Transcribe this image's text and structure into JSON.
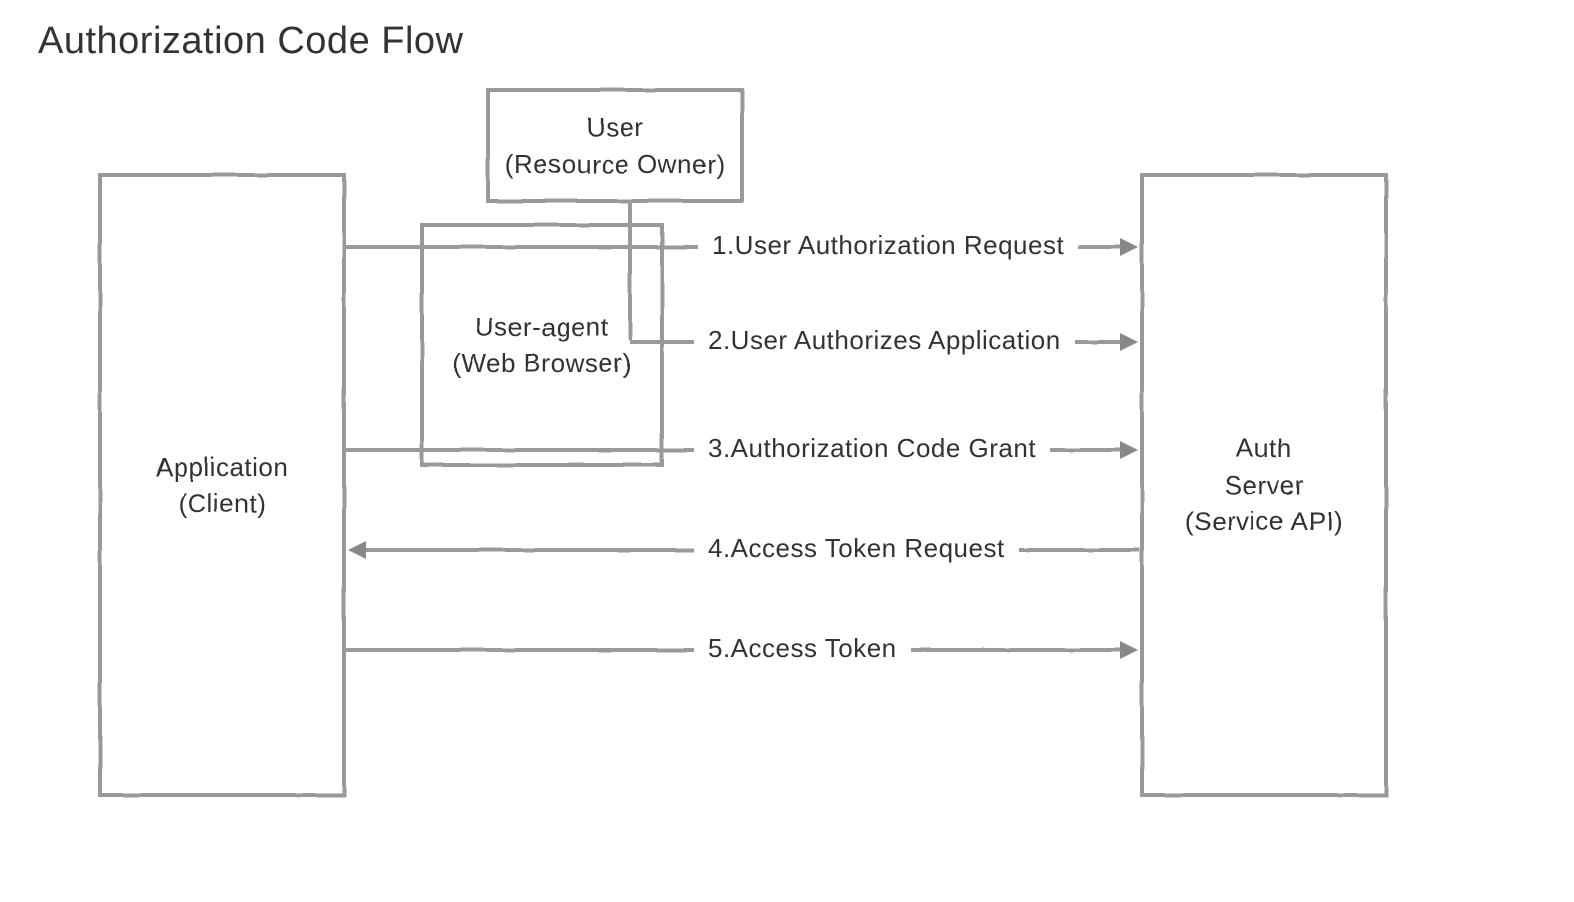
{
  "title": "Authorization Code Flow",
  "boxes": {
    "application": {
      "line1": "Application",
      "line2": "(Client)"
    },
    "user": {
      "line1": "User",
      "line2": "(Resource Owner)"
    },
    "user_agent": {
      "line1": "User-agent",
      "line2": "(Web Browser)"
    },
    "auth_server": {
      "line1": "Auth",
      "line2": "Server",
      "line3": "(Service API)"
    }
  },
  "steps": {
    "s1": "1.User Authorization Request",
    "s2": "2.User Authorizes Application",
    "s3": "3.Authorization Code Grant",
    "s4": "4.Access Token Request",
    "s5": "5.Access Token"
  }
}
